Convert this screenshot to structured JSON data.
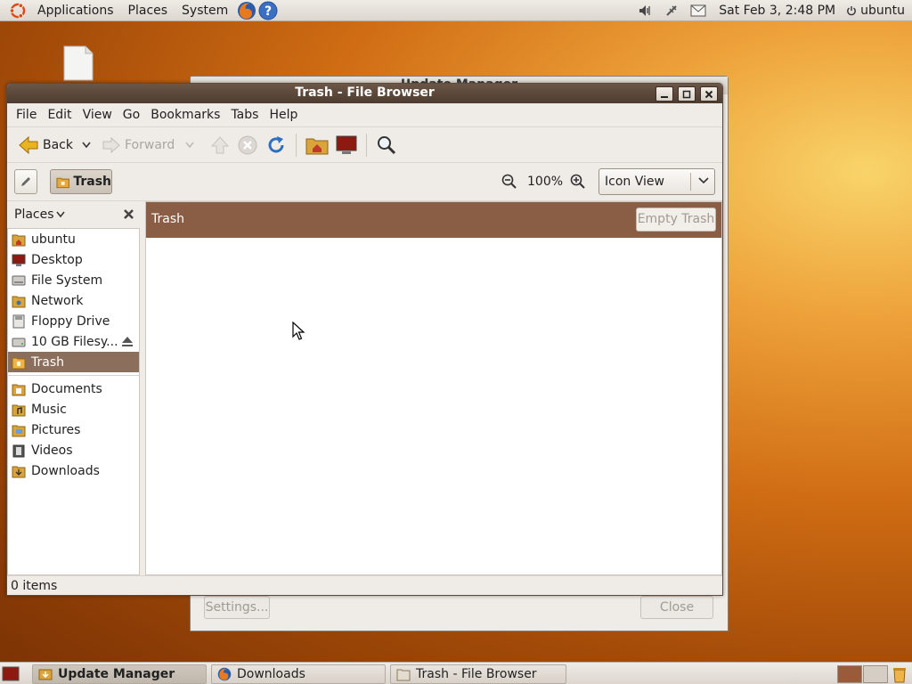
{
  "top_panel": {
    "menus": [
      "Applications",
      "Places",
      "System"
    ],
    "clock": "Sat Feb  3,  2:48 PM",
    "user": "ubuntu",
    "launcher_icons": [
      "firefox-icon",
      "help-icon"
    ],
    "indicator_icons": [
      "volume-icon",
      "network-icon",
      "mail-icon"
    ]
  },
  "background_window": {
    "title": "Update Manager",
    "settings_label": "Settings...",
    "close_label": "Close"
  },
  "file_browser": {
    "title": "Trash - File Browser",
    "menus": [
      {
        "label": "File",
        "mnemonic": "F"
      },
      {
        "label": "Edit",
        "mnemonic": "E"
      },
      {
        "label": "View",
        "mnemonic": "V"
      },
      {
        "label": "Go",
        "mnemonic": "G"
      },
      {
        "label": "Bookmarks",
        "mnemonic": "B"
      },
      {
        "label": "Tabs",
        "mnemonic": "T"
      },
      {
        "label": "Help",
        "mnemonic": "H"
      }
    ],
    "toolbar": {
      "back_label": "Back",
      "forward_label": "Forward"
    },
    "location": {
      "path_button": "Trash",
      "zoom_level": "100%",
      "view_mode": "Icon View"
    },
    "sidebar": {
      "header": "Places",
      "places": [
        {
          "label": "ubuntu",
          "icon": "home-folder-icon"
        },
        {
          "label": "Desktop",
          "icon": "desktop-icon"
        },
        {
          "label": "File System",
          "icon": "filesystem-icon"
        },
        {
          "label": "Network",
          "icon": "network-folder-icon"
        },
        {
          "label": "Floppy Drive",
          "icon": "floppy-icon"
        },
        {
          "label": "10 GB Filesy...",
          "icon": "harddisk-icon"
        },
        {
          "label": "Trash",
          "icon": "trash-icon",
          "selected": true
        }
      ],
      "bookmarks": [
        {
          "label": "Documents",
          "icon": "documents-folder-icon"
        },
        {
          "label": "Music",
          "icon": "music-folder-icon"
        },
        {
          "label": "Pictures",
          "icon": "pictures-folder-icon"
        },
        {
          "label": "Videos",
          "icon": "videos-folder-icon"
        },
        {
          "label": "Downloads",
          "icon": "downloads-folder-icon"
        }
      ]
    },
    "trash_bar": {
      "label": "Trash",
      "empty_button": "Empty Trash"
    },
    "status": "0 items"
  },
  "taskbar": {
    "tasks": [
      {
        "label": "Update Manager",
        "active": true
      },
      {
        "label": "Downloads",
        "active": false
      },
      {
        "label": "Trash - File Browser",
        "active": false
      }
    ]
  },
  "colors": {
    "selection": "#8b6e5c",
    "trash_bar": "#8a5d45",
    "titlebar": "#4e3c30"
  }
}
